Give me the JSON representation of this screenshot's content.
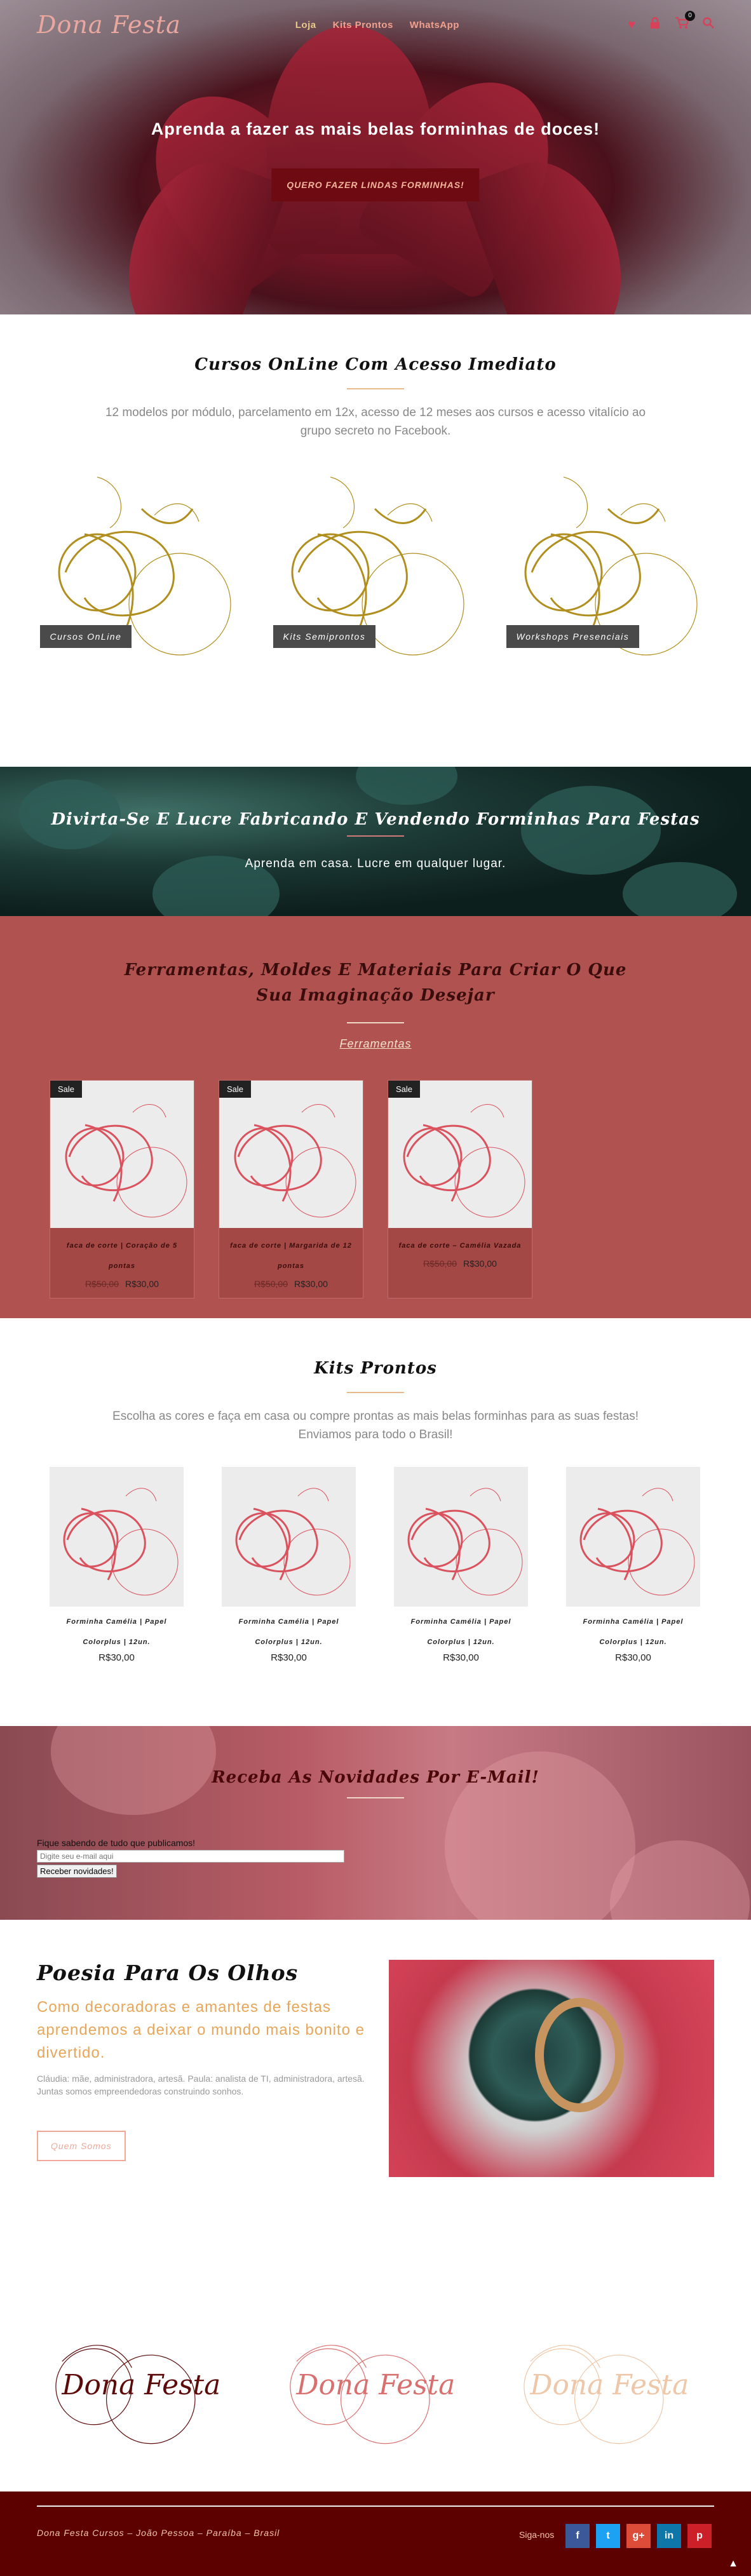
{
  "header": {
    "logo": "Dona Festa",
    "menu": [
      "Loja",
      "Kits Prontos",
      "WhatsApp"
    ],
    "cart_count": "0"
  },
  "hero": {
    "headline": "Aprenda a fazer as mais belas forminhas de doces!",
    "button": "QUERO FAZER LINDAS FORMINHAS!"
  },
  "cursos": {
    "title": "Cursos OnLine Com Acesso Imediato",
    "text": "12 modelos por módulo, parcelamento em 12x, acesso de 12 meses aos cursos e acesso vitalício ao grupo secreto no Facebook.",
    "categories": [
      "Cursos OnLine",
      "Kits Semiprontos",
      "Workshops Presenciais"
    ]
  },
  "divirta": {
    "title": "Divirta-Se E Lucre Fabricando E Vendendo Forminhas Para Festas",
    "text": "Aprenda em casa. Lucre em qualquer lugar."
  },
  "ferramentas": {
    "title": "Ferramentas, Moldes E Materiais Para Criar O Que Sua Imaginação Desejar",
    "link": "Ferramentas",
    "sale_label": "Sale",
    "products": [
      {
        "name": "faca de corte | Coração de 5 pontas",
        "old": "R$50,00",
        "price": "R$30,00"
      },
      {
        "name": "faca de corte | Margarida de 12 pontas",
        "old": "R$50,00",
        "price": "R$30,00"
      },
      {
        "name": "faca de corte – Camélia Vazada",
        "old": "R$50,00",
        "price": "R$30,00"
      }
    ]
  },
  "kits": {
    "title": "Kits Prontos",
    "text": "Escolha as cores e faça em casa ou compre prontas as mais belas forminhas para as suas festas! Enviamos para todo o Brasil!",
    "products": [
      {
        "name": "Forminha Camélia | Papel Colorplus | 12un.",
        "price": "R$30,00"
      },
      {
        "name": "Forminha Camélia | Papel Colorplus | 12un.",
        "price": "R$30,00"
      },
      {
        "name": "Forminha Camélia | Papel Colorplus | 12un.",
        "price": "R$30,00"
      },
      {
        "name": "Forminha Camélia | Papel Colorplus | 12un.",
        "price": "R$30,00"
      }
    ]
  },
  "news": {
    "title": "Receba As Novidades Por E-Mail!",
    "label": "Fique sabendo de tudo que publicamos!",
    "placeholder": "Digite seu e-mail aqui",
    "button": "Receber novidades!"
  },
  "poesia": {
    "title": "Poesia Para Os Olhos",
    "subtitle": "Como decoradoras e amantes de festas aprendemos a deixar o mundo mais bonito e divertido.",
    "body": "Cláudia: mãe, administradora, artesã. Paula: analista de TI, administradora, artesã. Juntas somos empreendedoras construindo sonhos.",
    "button": "Quem Somos"
  },
  "logos": [
    "Dona Festa",
    "Dona Festa",
    "Dona Festa"
  ],
  "footer": {
    "copy": "Dona Festa Cursos – João Pessoa – Paraíba – Brasil",
    "follow": "Siga-nos",
    "social": [
      "f",
      "t",
      "g+",
      "in",
      "p"
    ]
  },
  "colors": {
    "accent": "#f0a08e",
    "brand_dark": "#5c0000",
    "ferramentas_bg": "#b05350",
    "gold": "#b08f1e"
  }
}
